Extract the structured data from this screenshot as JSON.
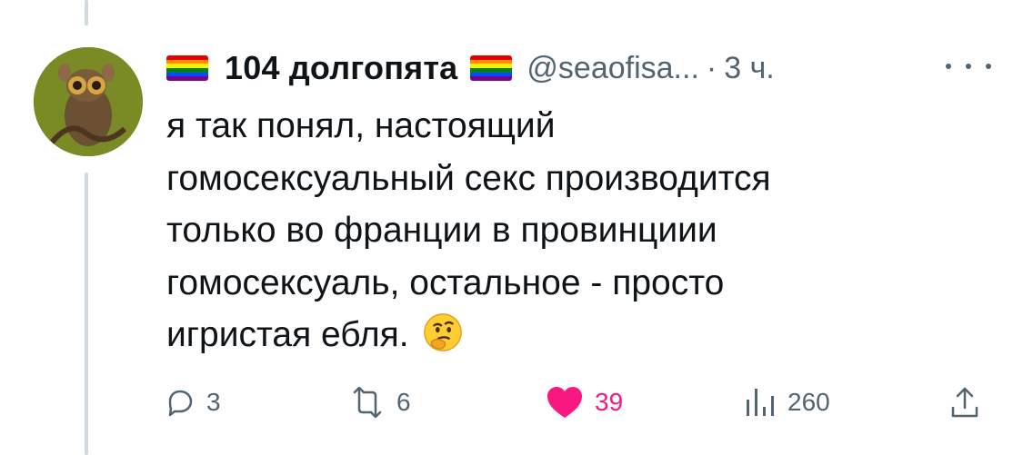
{
  "tweet": {
    "display_name": "104 долгопята",
    "handle": "@seaofisa...",
    "separator": "·",
    "time": "3 ч.",
    "text_lines": [
      "я так понял, настоящий",
      "гомосексуальный секс производится",
      "только во франции в провинциии",
      "гомосексуаль, остальное - просто",
      "игристая ебля."
    ]
  },
  "icons": {
    "name_prefix": "rainbow-flag-icon",
    "name_suffix": "rainbow-flag-icon",
    "emoji": "thinking-face-icon",
    "more": "more-dots-icon"
  },
  "actions": {
    "replies": "3",
    "reposts": "6",
    "likes": "39",
    "views": "260"
  },
  "colors": {
    "text": "#0f1419",
    "muted": "#536471",
    "like": "#f91880",
    "thread_line": "#cfd9de"
  }
}
